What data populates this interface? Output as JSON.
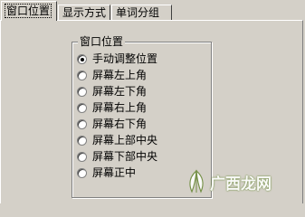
{
  "tabs": [
    {
      "label": "窗口位置",
      "active": true
    },
    {
      "label": "显示方式",
      "active": false
    },
    {
      "label": "单词分组",
      "active": false
    }
  ],
  "group": {
    "title": "窗口位置",
    "options": [
      {
        "label": "手动调整位置",
        "checked": true
      },
      {
        "label": "屏幕左上角",
        "checked": false
      },
      {
        "label": "屏幕左下角",
        "checked": false
      },
      {
        "label": "屏幕右上角",
        "checked": false
      },
      {
        "label": "屏幕右下角",
        "checked": false
      },
      {
        "label": "屏幕上部中央",
        "checked": false
      },
      {
        "label": "屏幕下部中央",
        "checked": false
      },
      {
        "label": "屏幕正中",
        "checked": false
      }
    ]
  },
  "watermark": {
    "text": "广西龙网",
    "icon": "leaf-logo-icon",
    "color": "#6b8a3a"
  },
  "colors": {
    "face": "#d4d0c8",
    "highlight": "#ffffff",
    "shadow": "#808080"
  }
}
